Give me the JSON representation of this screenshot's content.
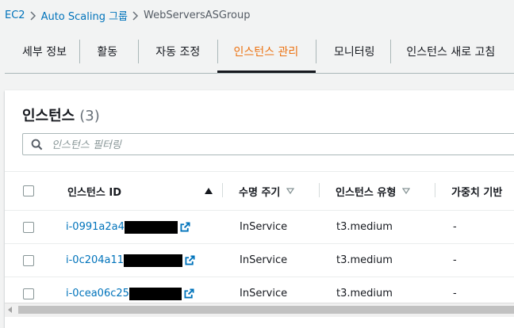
{
  "breadcrumb": {
    "items": [
      "EC2",
      "Auto Scaling 그룹"
    ],
    "current": "WebServersASGroup"
  },
  "tabs": [
    {
      "label": "세부 정보"
    },
    {
      "label": "활동"
    },
    {
      "label": "자동 조정"
    },
    {
      "label": "인스턴스 관리",
      "active": true
    },
    {
      "label": "모니터링"
    },
    {
      "label": "인스턴스 새로 고침"
    }
  ],
  "card": {
    "title": "인스턴스",
    "count": "(3)",
    "filter_placeholder": "인스턴스 필터링"
  },
  "table": {
    "headers": {
      "id": "인스턴스 ID",
      "lifecycle": "수명 주기",
      "type": "인스턴스 유형",
      "weight": "가중치 기반"
    },
    "rows": [
      {
        "id": "i-0991a2a4",
        "lifecycle": "InService",
        "type": "t3.medium",
        "weight": "-"
      },
      {
        "id": "i-0c204a11",
        "lifecycle": "InService",
        "type": "t3.medium",
        "weight": "-"
      },
      {
        "id": "i-0cea06c25",
        "lifecycle": "InService",
        "type": "t3.medium",
        "weight": "-"
      }
    ]
  },
  "colors": {
    "link": "#0073bb",
    "active_tab": "#ec7211",
    "text": "#16191f",
    "background": "#f2f3f3"
  }
}
